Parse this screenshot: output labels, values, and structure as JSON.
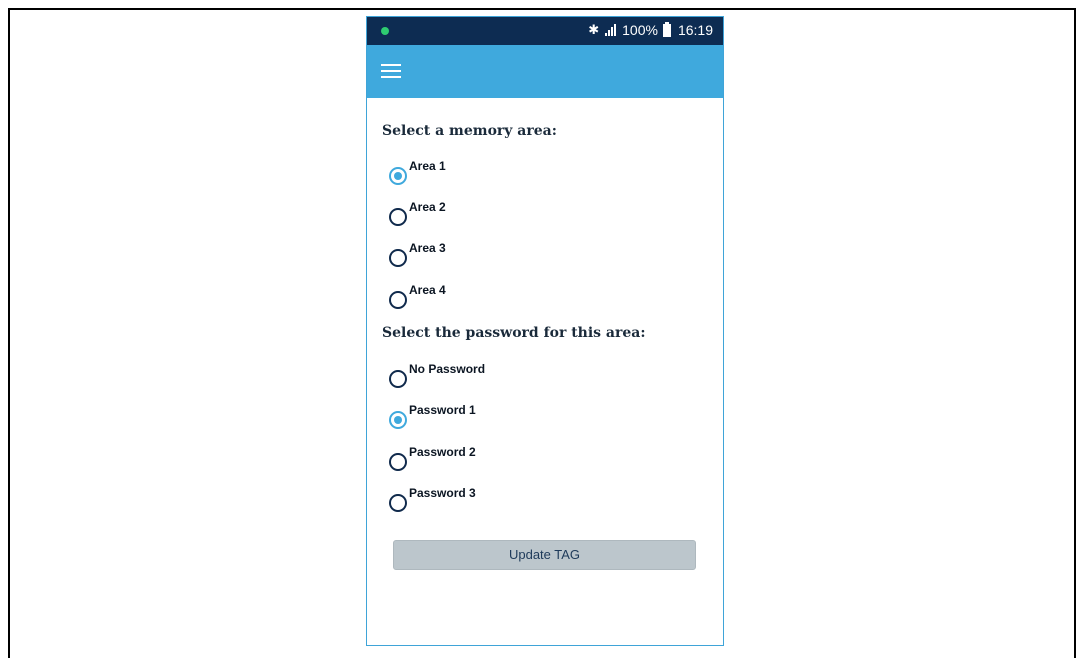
{
  "status_bar": {
    "battery_percent": "100%",
    "time": "16:19",
    "icons": [
      "notification-dot-icon",
      "bluetooth-icon",
      "signal-icon",
      "battery-icon"
    ]
  },
  "app_bar": {
    "menu_icon": "hamburger-menu-icon"
  },
  "memory_area": {
    "title": "Select a memory area:",
    "selected": "Area 1",
    "options": [
      "Area 1",
      "Area 2",
      "Area 3",
      "Area 4"
    ]
  },
  "password": {
    "title": "Select the password for this area:",
    "selected": "Password 1",
    "options": [
      "No Password",
      "Password 1",
      "Password 2",
      "Password 3"
    ]
  },
  "actions": {
    "update_label": "Update TAG"
  },
  "colors": {
    "status_bar_bg": "#0d2c52",
    "app_bar_bg": "#3fa9dd",
    "radio_checked": "#3fa9dd",
    "radio_unchecked": "#102a4c",
    "button_bg": "#bcc6cc"
  }
}
